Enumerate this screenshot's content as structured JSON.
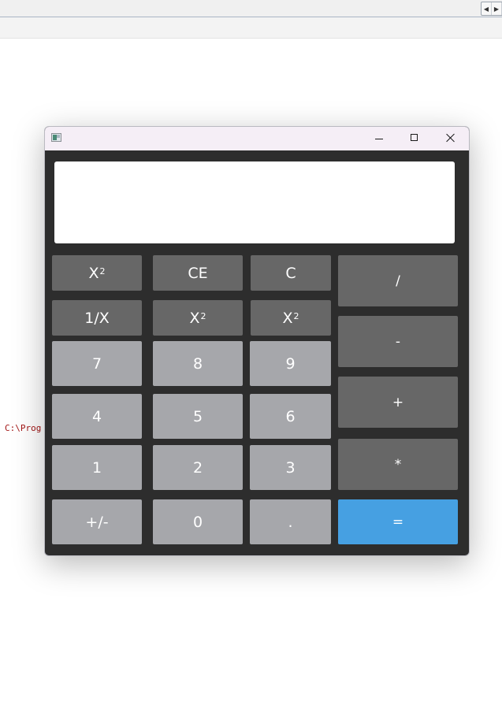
{
  "background": {
    "path_text": "C:\\Prog"
  },
  "window": {
    "buttons": {
      "minimize_icon": "minimize-icon",
      "maximize_icon": "maximize-icon",
      "close_icon": "close-icon"
    }
  },
  "display": {
    "value": ""
  },
  "keys": {
    "square_1": {
      "base": "X",
      "sup": "2"
    },
    "ce": "CE",
    "c": "C",
    "reciprocal": "1/X",
    "square_2": {
      "base": "X",
      "sup": "2"
    },
    "square_3": {
      "base": "X",
      "sup": "2"
    },
    "seven": "7",
    "eight": "8",
    "nine": "9",
    "four": "4",
    "five": "5",
    "six": "6",
    "one": "1",
    "two": "2",
    "three": "3",
    "negate": "+/-",
    "zero": "0",
    "decimal": ".",
    "divide": "/",
    "subtract": "-",
    "add": "+",
    "multiply": "*",
    "equals": "="
  },
  "colors": {
    "window_background": "#2d2d2d",
    "dark_key": "#676767",
    "light_key": "#a6a7ab",
    "equals_key": "#46a0e2",
    "titlebar": "#f5eef6",
    "path_text": "#a31515"
  }
}
